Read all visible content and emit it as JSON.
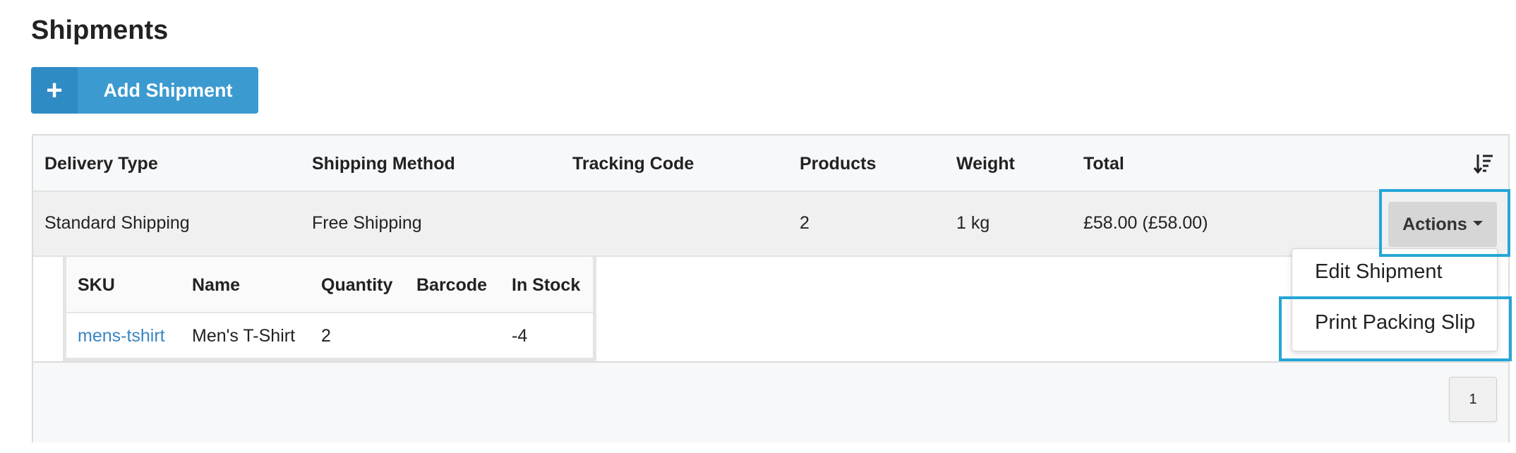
{
  "page": {
    "title": "Shipments"
  },
  "add_button": {
    "icon": "plus-icon",
    "label": "Add Shipment"
  },
  "table": {
    "columns": [
      "Delivery Type",
      "Shipping Method",
      "Tracking Code",
      "Products",
      "Weight",
      "Total"
    ],
    "sort_icon": "sort-descending-icon",
    "rows": [
      {
        "delivery_type": "Standard Shipping",
        "shipping_method": "Free Shipping",
        "tracking_code": "",
        "products": "2",
        "weight": "1 kg",
        "total": "£58.00 (£58.00)",
        "actions_label": "Actions"
      }
    ]
  },
  "actions_menu": {
    "items": [
      "Edit Shipment",
      "Print Packing Slip"
    ]
  },
  "products_table": {
    "columns": [
      "SKU",
      "Name",
      "Quantity",
      "Barcode",
      "In Stock"
    ],
    "rows": [
      {
        "sku": "mens-tshirt",
        "name": "Men's T-Shirt",
        "quantity": "2",
        "barcode": "",
        "in_stock": "-4"
      }
    ]
  },
  "pagination": {
    "current_page": "1"
  },
  "colors": {
    "primary": "#3b9ad0",
    "highlight": "#25a6d6",
    "link": "#3a86c2"
  }
}
